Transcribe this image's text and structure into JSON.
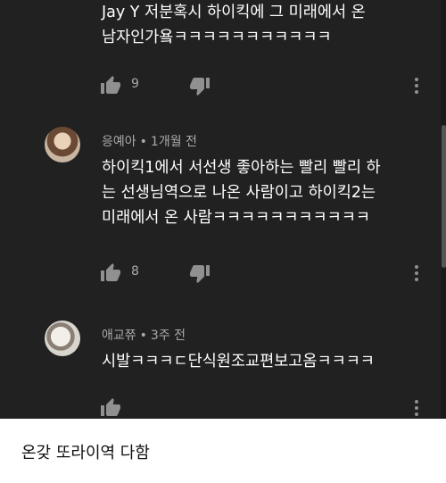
{
  "comments": [
    {
      "author": "",
      "time": "",
      "text": "Jay Y 저분혹시 하이킥에 그 미래에서 온\n남자인가욬ㅋㅋㅋㅋㅋㅋㅋㅋㅋㅋㅋ",
      "likes": "9"
    },
    {
      "author": "응예아",
      "time": "1개월 전",
      "text": "하이킥1에서 서선생 좋아하는 빨리 빨리 하\n는 선생님역으로 나온 사람이고 하이킥2는\n미래에서 온 사람ㅋㅋㅋㅋㅋㅋㅋㅋㅋㅋㅋ",
      "likes": "8"
    },
    {
      "author": "애교쮸",
      "time": "3주 전",
      "text": "시발ㅋㅋㅋㄷ단식원조교편보고옴ㅋㅋㅋㅋ",
      "likes": ""
    }
  ],
  "separator": "•",
  "caption": "온갖 또라이역 다함",
  "colors": {
    "panel_bg": "#212121",
    "meta": "#aaaaaa",
    "text": "#ffffff"
  },
  "icons": {
    "like": "thumbs-up-icon",
    "dislike": "thumbs-down-icon",
    "more": "more-vertical-icon"
  }
}
